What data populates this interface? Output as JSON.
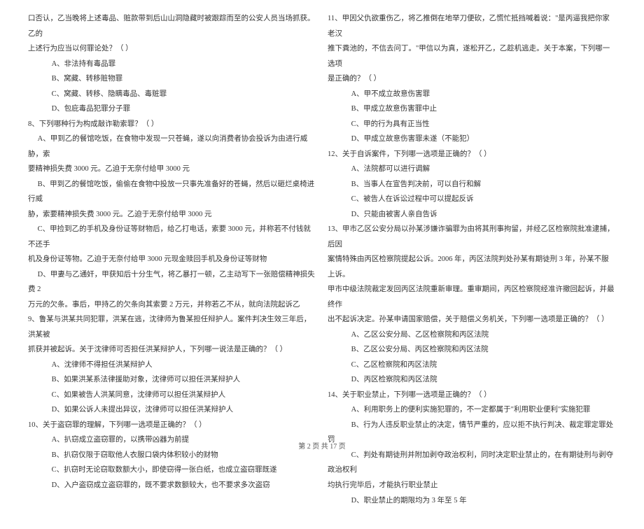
{
  "left": {
    "pre": [
      "口否认，乙当晚将上述毒品、赃款带到后山山洞隐藏时被跟踪而至的公安人员当场抓获。乙的",
      "上述行为应当以何罪论处？（    ）"
    ],
    "q7opts": [
      "A、非法持有毒品罪",
      "B、窝藏、转移赃物罪",
      "C、窝藏、转移、隐瞒毒品、毒赃罪",
      "D、包庇毒品犯罪分子罪"
    ],
    "q8": "8、下列哪种行为构成敲诈勒索罪？（      ）",
    "q8lines": [
      "A、甲到乙的餐馆吃饭，在食物中发现一只苍蝇，遂以向消费者协会投诉为由进行威胁，索",
      "要精神损失费 3000 元。乙迫于无奈付给甲 3000 元",
      "B、甲到乙的餐馆吃饭，偷偷在食物中投放一只事先准备好的苍蝇，然后以砸烂桌椅进行威",
      "胁，索要精神损失费 3000 元。乙迫于无奈付给甲 3000 元",
      "C、甲捡到乙的手机及身份证等财物后，给乙打电话，索要 3000 元，并称若不付钱就不还手",
      "机及身份证等物。乙迫于无奈付给甲 3000 元现金赎回手机及身份证等财物",
      "D、甲妻与乙通奸，甲获知后十分生气，将乙暴打一顿，乙主动写下一张赔偿精神损失费 2",
      "万元的欠条。事后，甲持乙的欠条向其索要 2 万元，并称若乙不从，就向法院起诉乙"
    ],
    "q9": "9、鲁某与洪某共同犯罪，洪某在逃，沈律师为鲁某担任辩护人。案件判决生效三年后，洪某被",
    "q9l2": "抓获并被起诉。关于沈律师可否担任洪某辩护人，下列哪一说法是正确的？（      ）",
    "q9opts": [
      "A、沈律师不得担任洪某辩护人",
      "B、如果洪某系法律援助对象，沈律师可以担任洪某辩护人",
      "C、如果被告人洪某同意，沈律师可以担任洪某辩护人",
      "D、如果公诉人未提出异议，沈律师可以担任洪某辩护人"
    ],
    "q10": "10、关于盗窃罪的理解，下列哪一选项是正确的？（    ）",
    "q10opts": [
      "A、扒窃成立盗窃罪的，以携带凶器为前提",
      "B、扒窃仅限于窃取他人衣服口袋内体积较小的财物",
      "C、扒窃时无论窃取数额大小，即使窃得一张白纸，也成立盗窃罪既遂",
      "D、入户盗窃成立盗窃罪的，既不要求数额较大，也不要求多次盗窃"
    ]
  },
  "right": {
    "q11": "11、甲因父仇欲重伤乙，将乙推倒在地举刀便砍，乙慌忙抵挡喊着说：\"是丙逼我把你家老汉",
    "q11l2": "推下粪池的，不信去问丁。\"甲信以为真，遂松开乙，乙趁机逃走。关于本案，下列哪一选项",
    "q11l3": "是正确的？（    ）",
    "q11opts": [
      "A、甲不成立故意伤害罪",
      "B、甲成立故意伤害罪中止",
      "C、甲的行为具有正当性",
      "D、甲成立故意伤害罪未遂（不能犯）"
    ],
    "q12": "12、关于自诉案件，下列哪一选项是正确的？（      ）",
    "q12opts": [
      "A、法院都可以进行调解",
      "B、当事人在宣告判决前，可以自行和解",
      "C、被告人在诉讼过程中可以提起反诉",
      "D、只能由被害人亲自告诉"
    ],
    "q13": "13、甲市乙区公安分局以孙某涉嫌诈骗罪为由将其刑事拘留，并经乙区检察院批准逮捕，后因",
    "q13l2": "案情特殊由丙区检察院提起公诉。2006 年，丙区法院判处孙某有期徒刑 3 年，孙某不服上诉。",
    "q13l3": "甲市中级法院裁定发回丙区法院重新审理。重审期间，丙区检察院经准许撤回起诉，并最终作",
    "q13l4": "出不起诉决定。孙某申请国家赔偿，关于赔偿义务机关，下列哪一选项是正确的？（    ）",
    "q13opts": [
      "A、乙区公安分局、乙区检察院和丙区法院",
      "B、乙区公安分局、丙区检察院和丙区法院",
      "C、乙区检察院和丙区法院",
      "D、丙区检察院和丙区法院"
    ],
    "q14": "14、关于职业禁止，下列哪一选项是正确的？（    ）",
    "q14opts": [
      "A、利用职务上的便利实施犯罪的，不一定都属于\"利用职业便利\"实施犯罪",
      "B、行为人违反职业禁止的决定，情节严重的，应以拒不执行判决、裁定罪定罪处罚",
      "C、判处有期徒刑并附加剥夺政治权利，同时决定职业禁止的，在有期徒刑与剥夺政治权利"
    ],
    "q14l2": "均执行完毕后，才能执行职业禁止",
    "q14d": "D、职业禁止的期限均为 3 年至 5 年"
  },
  "footer": "第 2 页 共 17 页"
}
